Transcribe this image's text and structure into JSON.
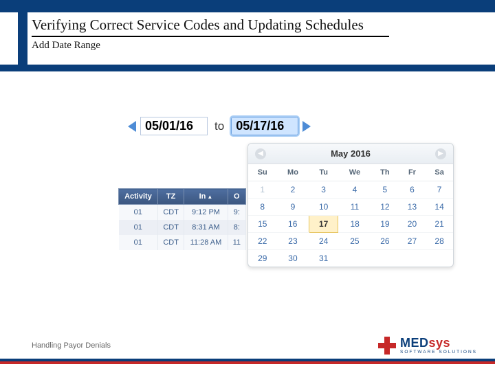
{
  "header": {
    "title": "Verifying Correct Service Codes and Updating Schedules",
    "subtitle": "Add Date Range"
  },
  "dateRange": {
    "from": "05/01/16",
    "toLabel": "to",
    "to": "05/17/16"
  },
  "calendar": {
    "title": "May 2016",
    "prevGlyph": "◀",
    "nextGlyph": "▶",
    "dow": [
      "Su",
      "Mo",
      "Tu",
      "We",
      "Th",
      "Fr",
      "Sa"
    ],
    "weeks": [
      [
        {
          "d": 1,
          "dim": true
        },
        {
          "d": 2
        },
        {
          "d": 3
        },
        {
          "d": 4
        },
        {
          "d": 5
        },
        {
          "d": 6
        },
        {
          "d": 7
        }
      ],
      [
        {
          "d": 8
        },
        {
          "d": 9
        },
        {
          "d": 10
        },
        {
          "d": 11
        },
        {
          "d": 12
        },
        {
          "d": 13
        },
        {
          "d": 14
        }
      ],
      [
        {
          "d": 15
        },
        {
          "d": 16
        },
        {
          "d": 17,
          "selected": true
        },
        {
          "d": 18
        },
        {
          "d": 19
        },
        {
          "d": 20
        },
        {
          "d": 21
        }
      ],
      [
        {
          "d": 22
        },
        {
          "d": 23
        },
        {
          "d": 24
        },
        {
          "d": 25
        },
        {
          "d": 26
        },
        {
          "d": 27
        },
        {
          "d": 28
        }
      ],
      [
        {
          "d": 29
        },
        {
          "d": 30
        },
        {
          "d": 31
        },
        {
          "d": ""
        },
        {
          "d": ""
        },
        {
          "d": ""
        },
        {
          "d": ""
        }
      ]
    ]
  },
  "activityTable": {
    "headers": [
      "Activity",
      "TZ",
      "In",
      "O"
    ],
    "sortArrow": "▲",
    "rows": [
      {
        "activity": "01",
        "tz": "CDT",
        "in": "9:12 PM",
        "out": "9:"
      },
      {
        "activity": "01",
        "tz": "CDT",
        "in": "8:31 AM",
        "out": "8:"
      },
      {
        "activity": "01",
        "tz": "CDT",
        "in": "11:28 AM",
        "out": "11"
      }
    ]
  },
  "footer": {
    "text": "Handling Payor Denials",
    "logoMain1": "MED",
    "logoMain2": "sys",
    "logoSub": "SOFTWARE SOLUTIONS"
  }
}
